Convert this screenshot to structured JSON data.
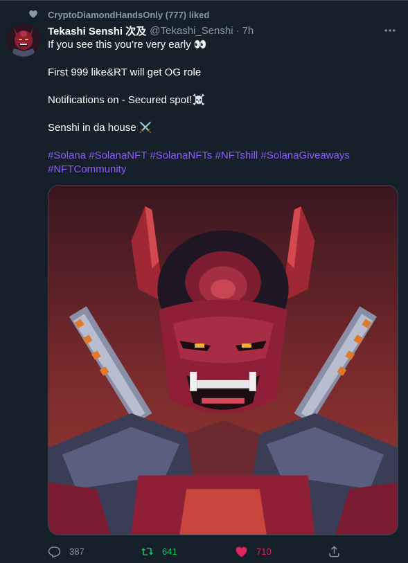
{
  "social_context": {
    "text": "CryptoDiamondHandsOnly (777) liked"
  },
  "tweet": {
    "display_name": "Tekashi Senshi 次及",
    "handle": "@Tekashi_Senshi",
    "separator": "·",
    "time": "7h",
    "lines": {
      "line1": "If you see this you’re very early 👀",
      "line2": "First 999 like&RT will get OG role",
      "line3": "Notifications on - Secured spot!☠️",
      "line4": "Senshi in da house ⚔️"
    },
    "hashtags": {
      "h1": "#Solana",
      "h2": "#SolanaNFT",
      "h3": "#SolanaNFTs",
      "h4": "#NFTshill",
      "h5": "#SolanaGiveaways",
      "h6": "#NFTCommunity"
    }
  },
  "actions": {
    "reply_count": "387",
    "retweet_count": "641",
    "like_count": "710"
  },
  "colors": {
    "background": "#15202b",
    "hashtag": "#8d5cf6",
    "retweet_active": "#17bf63",
    "like_active": "#e0245e",
    "muted": "#8899a6"
  },
  "icons": [
    "heart-icon",
    "more-icon",
    "reply-icon",
    "retweet-icon",
    "like-icon",
    "share-icon"
  ]
}
